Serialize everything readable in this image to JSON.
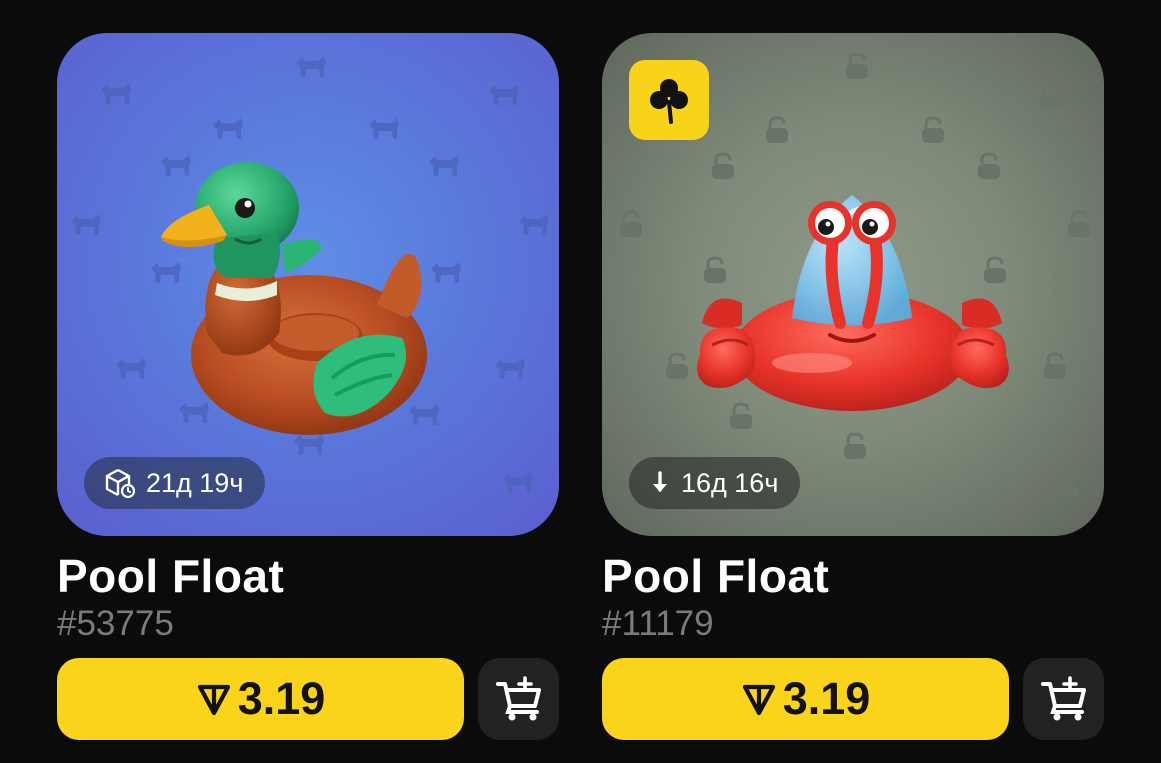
{
  "cards": [
    {
      "title": "Pool Float",
      "number": "#53775",
      "badge_icon": "cube-clock-icon",
      "badge_text": "21д 19ч",
      "price": "3.19",
      "currency_icon": "ton-icon",
      "background": "#5a78dc",
      "pattern_icon": "wolf-silhouette-icon",
      "art": "duck-pool-float"
    },
    {
      "title": "Pool Float",
      "number": "#11179",
      "badge_icon": "arrow-down-icon",
      "badge_text": "16д 16ч",
      "price": "3.19",
      "currency_icon": "ton-icon",
      "background": "#7f8a7a",
      "pattern_icon": "padlock-icon",
      "corner_tag_icon": "clover-icon",
      "art": "crab-pool-float"
    }
  ],
  "colors": {
    "accent": "#f9d41a",
    "page_background": "#0b0b0b",
    "number_text": "#7b7b7b"
  }
}
